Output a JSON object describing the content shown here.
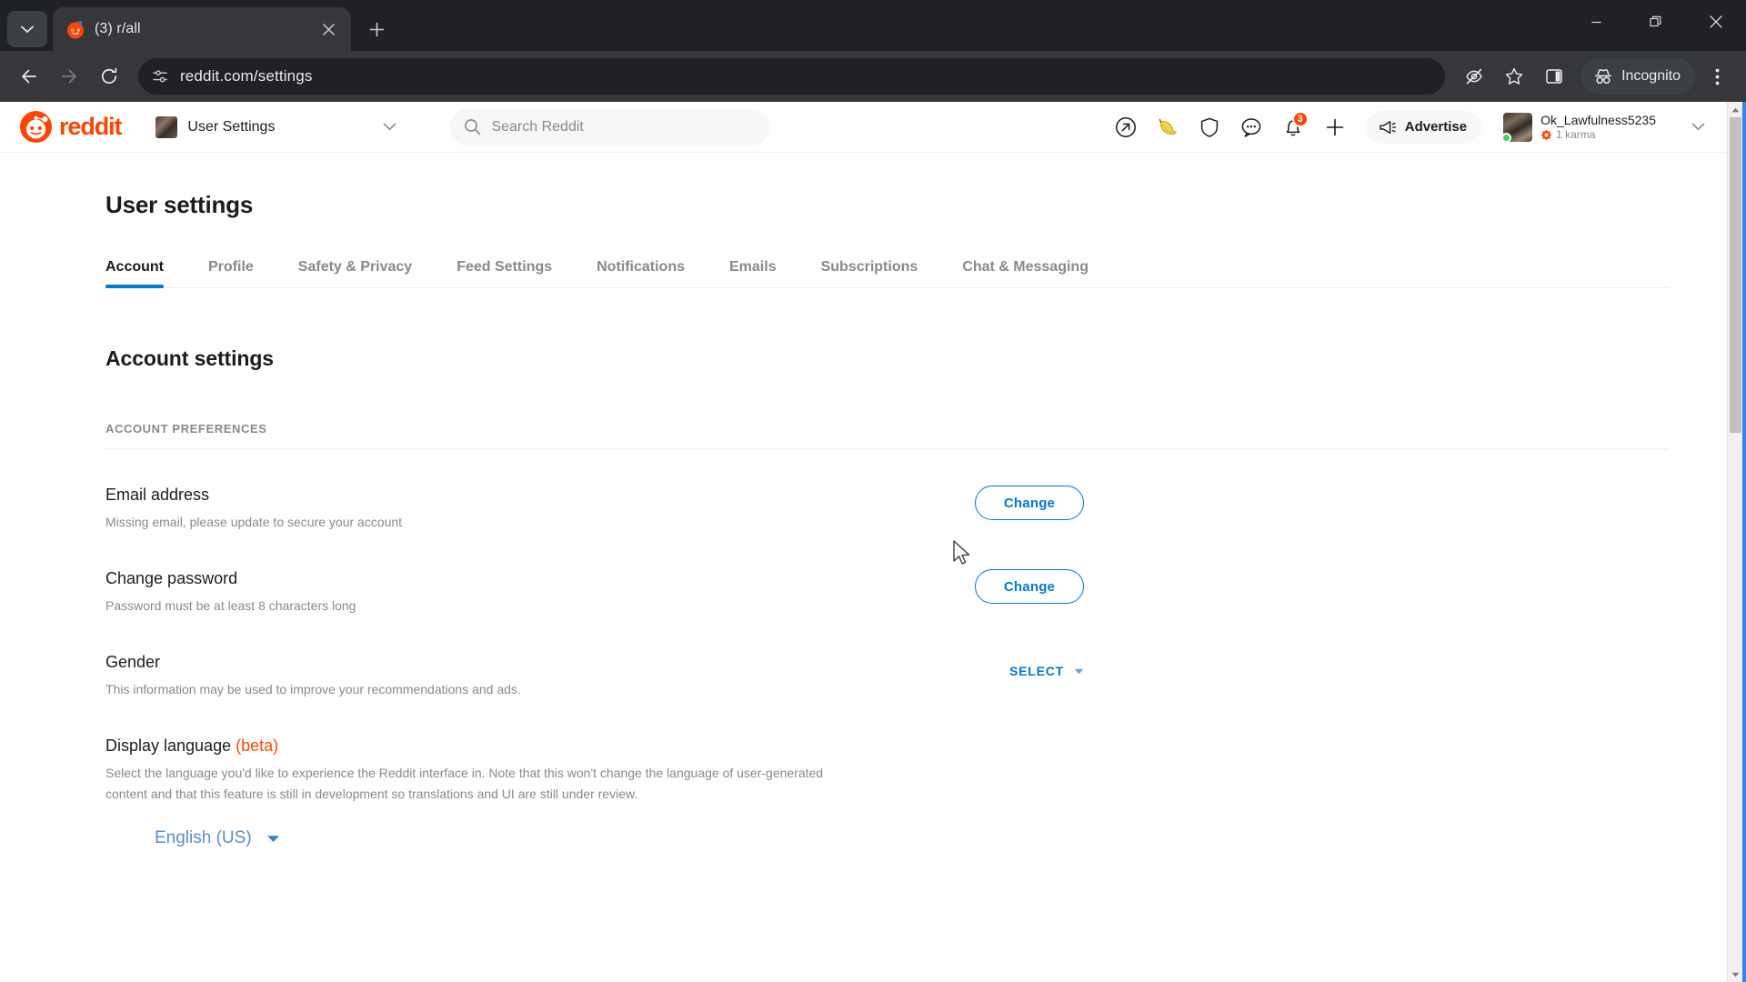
{
  "browser": {
    "tab": {
      "title": "(3) r/all",
      "favicon_icon": "reddit-favicon"
    },
    "new_tab_label": "+",
    "tab_search_icon": "chevron-down-icon",
    "window_controls": {
      "minimize": "minimize-icon",
      "maximize": "restore-icon",
      "close": "close-icon"
    },
    "nav": {
      "back_icon": "back-arrow-icon",
      "forward_icon": "forward-arrow-icon",
      "reload_icon": "reload-icon"
    },
    "omnibox": {
      "site_settings_icon": "tune-icon",
      "url": "reddit.com/settings"
    },
    "actions": {
      "hide_icon": "eye-off-icon",
      "bookmark_icon": "star-icon",
      "side_panel_icon": "side-panel-icon",
      "incognito_label": "Incognito",
      "incognito_icon": "incognito-icon",
      "menu_icon": "three-dot-menu-icon"
    }
  },
  "reddit_header": {
    "logo_text": "reddit",
    "logo_icon": "reddit-snoo-icon",
    "community_switcher": {
      "label": "User Settings",
      "avatar": "community-avatar",
      "caret_icon": "chevron-down-icon"
    },
    "search": {
      "placeholder": "Search Reddit",
      "icon": "search-icon"
    },
    "icons": [
      {
        "name": "popular-icon",
        "glyph": "arrow-up-right-circle"
      },
      {
        "name": "banana-icon",
        "glyph": "banana"
      },
      {
        "name": "shield-icon",
        "glyph": "shield"
      },
      {
        "name": "chat-icon",
        "glyph": "speech-bubble"
      },
      {
        "name": "notifications-icon",
        "glyph": "bell",
        "badge": "3"
      },
      {
        "name": "create-post-icon",
        "glyph": "plus"
      }
    ],
    "advertise": {
      "label": "Advertise",
      "icon": "megaphone-icon"
    },
    "user": {
      "name": "Ok_Lawfulness5235",
      "karma": "1 karma",
      "karma_icon": "karma-icon",
      "status": "online",
      "caret_icon": "chevron-down-icon"
    }
  },
  "settings": {
    "page_title": "User settings",
    "tabs": [
      {
        "label": "Account",
        "active": true
      },
      {
        "label": "Profile",
        "active": false
      },
      {
        "label": "Safety & Privacy",
        "active": false
      },
      {
        "label": "Feed Settings",
        "active": false
      },
      {
        "label": "Notifications",
        "active": false
      },
      {
        "label": "Emails",
        "active": false
      },
      {
        "label": "Subscriptions",
        "active": false
      },
      {
        "label": "Chat & Messaging",
        "active": false
      }
    ],
    "section_title": "Account settings",
    "group_label": "ACCOUNT PREFERENCES",
    "rows": {
      "email": {
        "title": "Email address",
        "desc": "Missing email, please update to secure your account",
        "button": "Change"
      },
      "password": {
        "title": "Change password",
        "desc": "Password must be at least 8 characters long",
        "button": "Change"
      },
      "gender": {
        "title": "Gender",
        "desc": "This information may be used to improve your recommendations and ads.",
        "select_label": "SELECT"
      },
      "language": {
        "title": "Display language",
        "beta": "(beta)",
        "desc": "Select the language you'd like to experience the Reddit interface in. Note that this won't change the language of user-generated content and that this feature is still in development so translations and UI are still under review.",
        "value": "English (US)"
      }
    }
  },
  "colors": {
    "reddit_orange": "#ff4500",
    "link_blue": "#0079d3",
    "text_primary": "#1c1c1c",
    "text_muted": "#878a8c",
    "focus_blue": "#3b7fe8"
  }
}
